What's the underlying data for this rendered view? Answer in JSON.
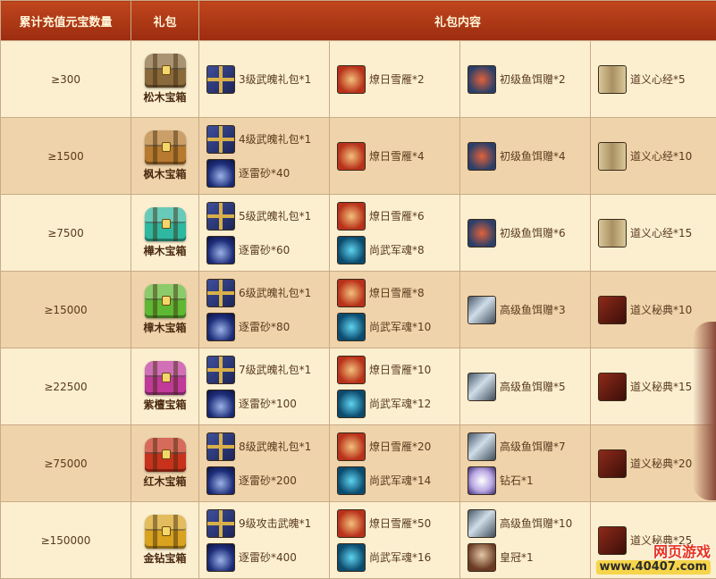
{
  "header": {
    "col1": "累计充值元宝数量",
    "col2": "礼包",
    "col3": "礼包内容"
  },
  "colors": {
    "header_bg": "#a8341a",
    "row_odd": "#fbefd0",
    "row_even": "#efd3aa"
  },
  "rows": [
    {
      "amount": "≥300",
      "pack": {
        "name": "松木宝箱",
        "color": "#8a6a3c"
      },
      "cols": [
        [
          {
            "icon": "gift-pack-icon",
            "cls": "giftpack",
            "text": "3级武魄礼包*1"
          }
        ],
        [
          {
            "icon": "snow-goose-icon",
            "cls": "bird",
            "text": "燎日雪雁*2"
          }
        ],
        [
          {
            "icon": "shrimp-bait-icon",
            "cls": "shrimp",
            "text": "初级鱼饵赠*2"
          }
        ],
        [
          {
            "icon": "scroll-icon",
            "cls": "scroll",
            "text": "道义心经*5"
          }
        ]
      ]
    },
    {
      "amount": "≥1500",
      "pack": {
        "name": "枫木宝箱",
        "color": "#b77a2e"
      },
      "cols": [
        [
          {
            "icon": "gift-pack-icon",
            "cls": "giftpack",
            "text": "4级武魄礼包*1"
          },
          {
            "icon": "thunder-sand-icon",
            "cls": "sand",
            "text": "逐雷砂*40"
          }
        ],
        [
          {
            "icon": "snow-goose-icon",
            "cls": "bird",
            "text": "燎日雪雁*4"
          }
        ],
        [
          {
            "icon": "shrimp-bait-icon",
            "cls": "shrimp",
            "text": "初级鱼饵赠*4"
          }
        ],
        [
          {
            "icon": "scroll-icon",
            "cls": "scroll",
            "text": "道义心经*10"
          }
        ]
      ]
    },
    {
      "amount": "≥7500",
      "pack": {
        "name": "樺木宝箱",
        "color": "#2fb8a0"
      },
      "cols": [
        [
          {
            "icon": "gift-pack-icon",
            "cls": "giftpack",
            "text": "5级武魄礼包*1"
          },
          {
            "icon": "thunder-sand-icon",
            "cls": "sand",
            "text": "逐雷砂*60"
          }
        ],
        [
          {
            "icon": "snow-goose-icon",
            "cls": "bird",
            "text": "燎日雪雁*6"
          },
          {
            "icon": "army-soul-icon",
            "cls": "soul",
            "text": "尚武军魂*8"
          }
        ],
        [
          {
            "icon": "shrimp-bait-icon",
            "cls": "shrimp",
            "text": "初级鱼饵赠*6"
          }
        ],
        [
          {
            "icon": "scroll-icon",
            "cls": "scroll",
            "text": "道义心经*15"
          }
        ]
      ]
    },
    {
      "amount": "≥15000",
      "pack": {
        "name": "樟木宝箱",
        "color": "#5fb833"
      },
      "cols": [
        [
          {
            "icon": "gift-pack-icon",
            "cls": "giftpack",
            "text": "6级武魄礼包*1"
          },
          {
            "icon": "thunder-sand-icon",
            "cls": "sand",
            "text": "逐雷砂*80"
          }
        ],
        [
          {
            "icon": "snow-goose-icon",
            "cls": "bird",
            "text": "燎日雪雁*8"
          },
          {
            "icon": "army-soul-icon",
            "cls": "soul",
            "text": "尚武军魂*10"
          }
        ],
        [
          {
            "icon": "fish-bait-icon",
            "cls": "fish",
            "text": "高级鱼饵赠*3"
          }
        ],
        [
          {
            "icon": "secret-book-icon",
            "cls": "book",
            "text": "道义秘典*10"
          }
        ]
      ]
    },
    {
      "amount": "≥22500",
      "pack": {
        "name": "紫檀宝箱",
        "color": "#c03a9a"
      },
      "cols": [
        [
          {
            "icon": "gift-pack-icon",
            "cls": "giftpack",
            "text": "7级武魄礼包*1"
          },
          {
            "icon": "thunder-sand-icon",
            "cls": "sand",
            "text": "逐雷砂*100"
          }
        ],
        [
          {
            "icon": "snow-goose-icon",
            "cls": "bird",
            "text": "燎日雪雁*10"
          },
          {
            "icon": "army-soul-icon",
            "cls": "soul",
            "text": "尚武军魂*12"
          }
        ],
        [
          {
            "icon": "fish-bait-icon",
            "cls": "fish",
            "text": "高级鱼饵赠*5"
          }
        ],
        [
          {
            "icon": "secret-book-icon",
            "cls": "book",
            "text": "道义秘典*15"
          }
        ]
      ]
    },
    {
      "amount": "≥75000",
      "pack": {
        "name": "红木宝箱",
        "color": "#c8321c"
      },
      "cols": [
        [
          {
            "icon": "gift-pack-icon",
            "cls": "giftpack",
            "text": "8级武魄礼包*1"
          },
          {
            "icon": "thunder-sand-icon",
            "cls": "sand",
            "text": "逐雷砂*200"
          }
        ],
        [
          {
            "icon": "snow-goose-icon",
            "cls": "bird",
            "text": "燎日雪雁*20"
          },
          {
            "icon": "army-soul-icon",
            "cls": "soul",
            "text": "尚武军魂*14"
          }
        ],
        [
          {
            "icon": "fish-bait-icon",
            "cls": "fish",
            "text": "高级鱼饵赠*7"
          },
          {
            "icon": "diamond-icon",
            "cls": "diamond",
            "text": "钻石*1"
          }
        ],
        [
          {
            "icon": "secret-book-icon",
            "cls": "book",
            "text": "道义秘典*20"
          }
        ]
      ]
    },
    {
      "amount": "≥150000",
      "pack": {
        "name": "金钻宝箱",
        "color": "#d9a21f"
      },
      "cols": [
        [
          {
            "icon": "gift-pack-icon",
            "cls": "giftpack",
            "text": "9级攻击武魄*1"
          },
          {
            "icon": "thunder-sand-icon",
            "cls": "sand",
            "text": "逐雷砂*400"
          }
        ],
        [
          {
            "icon": "snow-goose-icon",
            "cls": "bird",
            "text": "燎日雪雁*50"
          },
          {
            "icon": "army-soul-icon",
            "cls": "soul",
            "text": "尚武军魂*16"
          }
        ],
        [
          {
            "icon": "fish-bait-icon",
            "cls": "fish",
            "text": "高级鱼饵赠*10"
          },
          {
            "icon": "crown-icon",
            "cls": "crown",
            "text": "皇冠*1"
          }
        ],
        [
          {
            "icon": "secret-book-icon",
            "cls": "book",
            "text": "道义秘典*25"
          }
        ]
      ]
    }
  ],
  "watermark": {
    "line1": "网页游戏",
    "line2": "www.40407.com"
  }
}
